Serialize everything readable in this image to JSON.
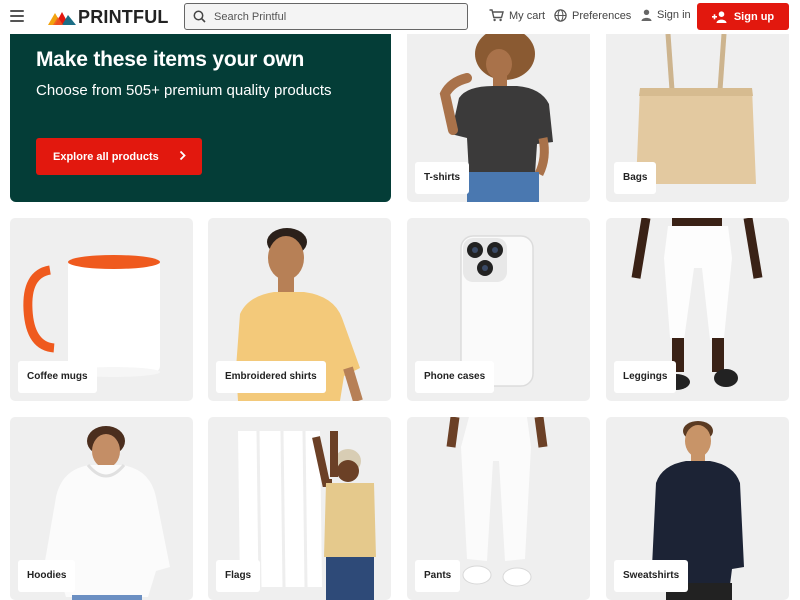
{
  "header": {
    "logo_text": "PRINTFUL",
    "search_placeholder": "Search Printful",
    "cart_label": "My cart",
    "preferences_label": "Preferences",
    "signin_label": "Sign in",
    "signup_label": "Sign up"
  },
  "hero": {
    "title": "Make these items your own",
    "subtitle": "Choose from 505+ premium quality products",
    "button_label": "Explore all products"
  },
  "categories": [
    {
      "label": "T-shirts"
    },
    {
      "label": "Bags"
    },
    {
      "label": "Coffee mugs"
    },
    {
      "label": "Embroidered shirts"
    },
    {
      "label": "Phone cases"
    },
    {
      "label": "Leggings"
    },
    {
      "label": "Hoodies"
    },
    {
      "label": "Flags"
    },
    {
      "label": "Pants"
    },
    {
      "label": "Sweatshirts"
    }
  ],
  "colors": {
    "brand_red": "#e2180e",
    "hero_green": "#043d37",
    "card_bg": "#efefef"
  }
}
